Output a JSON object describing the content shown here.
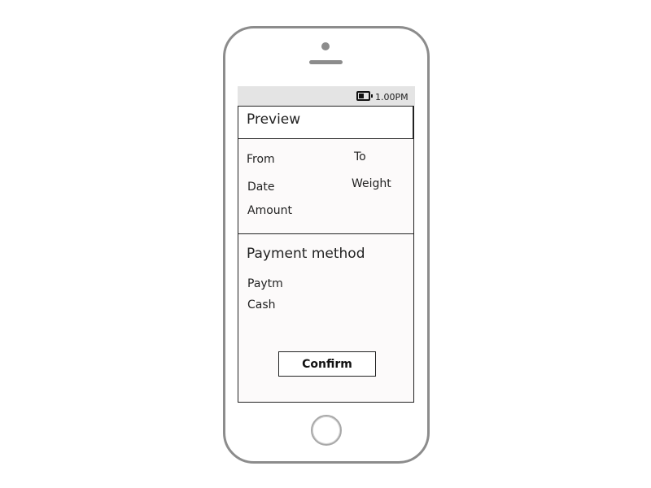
{
  "status_bar": {
    "time": "1.00PM",
    "battery_icon": "battery-icon"
  },
  "preview": {
    "title": "Preview",
    "from_label": "From",
    "to_label": "To",
    "date_label": "Date",
    "weight_label": "Weight",
    "amount_label": "Amount"
  },
  "payment": {
    "title": "Payment method",
    "options": [
      "Paytm",
      "Cash"
    ]
  },
  "confirm_label": "Confirm"
}
